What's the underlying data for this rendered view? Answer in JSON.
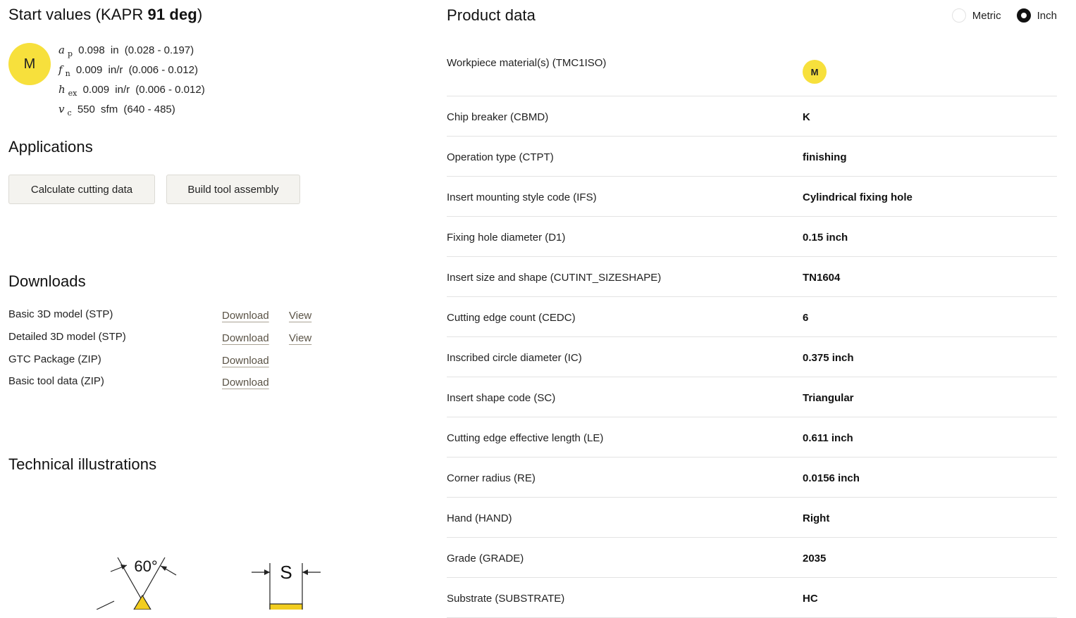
{
  "start_values": {
    "title_prefix": "Start values  (KAPR ",
    "title_bold": "91 deg",
    "title_suffix": ")",
    "material_badge": "M",
    "rows": [
      {
        "symbol": "a",
        "sub": "p",
        "value": "0.098",
        "unit": "in",
        "range": "(0.028 - 0.197)"
      },
      {
        "symbol": "f",
        "sub": "n",
        "value": "0.009",
        "unit": "in/r",
        "range": "(0.006 - 0.012)"
      },
      {
        "symbol": "h",
        "sub": "ex",
        "value": "0.009",
        "unit": "in/r",
        "range": "(0.006 - 0.012)"
      },
      {
        "symbol": "v",
        "sub": "c",
        "value": "550",
        "unit": "sfm",
        "range": "(640 - 485)"
      }
    ]
  },
  "applications": {
    "title": "Applications",
    "calculate_label": "Calculate cutting data",
    "build_label": "Build tool assembly"
  },
  "downloads": {
    "title": "Downloads",
    "items": [
      {
        "name": "Basic 3D model (STP)",
        "download": "Download",
        "view": "View"
      },
      {
        "name": "Detailed 3D model (STP)",
        "download": "Download",
        "view": "View"
      },
      {
        "name": "GTC Package (ZIP)",
        "download": "Download",
        "view": ""
      },
      {
        "name": "Basic tool data (ZIP)",
        "download": "Download",
        "view": ""
      }
    ]
  },
  "technical": {
    "title": "Technical illustrations",
    "angle_label": "60°",
    "thickness_label": "S",
    "accent_color": "#f2cd1f"
  },
  "product_data": {
    "title": "Product data",
    "units": {
      "metric": "Metric",
      "inch": "Inch",
      "selected": "Inch"
    },
    "rows": [
      {
        "label": "Workpiece material(s)  (TMC1ISO)",
        "value": "M",
        "badge": true
      },
      {
        "label": "Chip breaker  (CBMD)",
        "value": "K"
      },
      {
        "label": "Operation type   (CTPT)",
        "value": "finishing"
      },
      {
        "label": "Insert mounting style code  (IFS)",
        "value": "Cylindrical fixing hole"
      },
      {
        "label": "Fixing hole diameter  (D1)",
        "value": "0.15 inch"
      },
      {
        "label": "Insert size and shape   (CUTINT_SIZESHAPE)",
        "value": "TN1604"
      },
      {
        "label": "Cutting edge count  (CEDC)",
        "value": "6"
      },
      {
        "label": "Inscribed circle diameter  (IC)",
        "value": "0.375 inch"
      },
      {
        "label": "Insert shape code  (SC)",
        "value": "Triangular"
      },
      {
        "label": "Cutting edge effective length  (LE)",
        "value": "0.611 inch"
      },
      {
        "label": "Corner radius   (RE)",
        "value": "0.0156 inch"
      },
      {
        "label": "Hand   (HAND)",
        "value": "Right"
      },
      {
        "label": "Grade   (GRADE)",
        "value": "2035"
      },
      {
        "label": "Substrate  (SUBSTRATE)",
        "value": "HC"
      }
    ]
  },
  "colors": {
    "badge_yellow": "#f7e03c",
    "button_bg": "#f4f3ef",
    "link": "#5a5346"
  }
}
